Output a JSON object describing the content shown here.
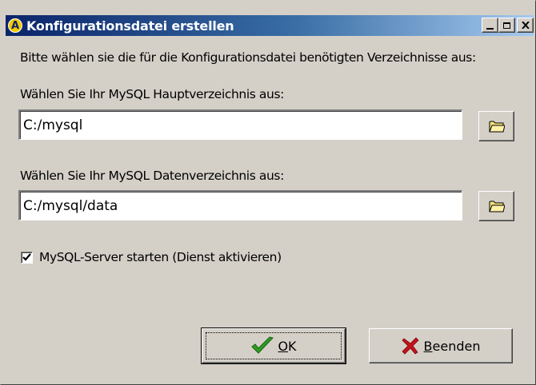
{
  "window": {
    "title": "Konfigurationsdatei erstellen",
    "app_icon_glyph": "A",
    "minimize_label": "_",
    "maximize_label": "□",
    "close_label": "x"
  },
  "dialog": {
    "intro_text": "Bitte wählen sie die für die Konfigurationsdatei benötigten Verzeichnisse aus:",
    "main_dir_label": "Wählen Sie Ihr MySQL Hauptverzeichnis aus:",
    "main_dir_value": "C:/mysql",
    "data_dir_label": "Wählen Sie Ihr MySQL  Datenverzeichnis aus:",
    "data_dir_value": "C:/mysql/data",
    "start_server_label": "MySQL-Server starten (Dienst aktivieren)",
    "start_server_checked": true
  },
  "buttons": {
    "ok_accel": "O",
    "ok_rest": "K",
    "cancel_accel": "B",
    "cancel_rest": "eenden"
  },
  "icons": {
    "browse": "folder-icon",
    "ok": "green-checkmark-icon",
    "cancel": "red-x-icon"
  },
  "colors": {
    "face": "#d4d0c8",
    "title_start": "#0a246a",
    "title_end": "#a6caf0",
    "folder": "#f5e17a",
    "check_green": "#2e9e1f",
    "cancel_red": "#c4121a"
  }
}
